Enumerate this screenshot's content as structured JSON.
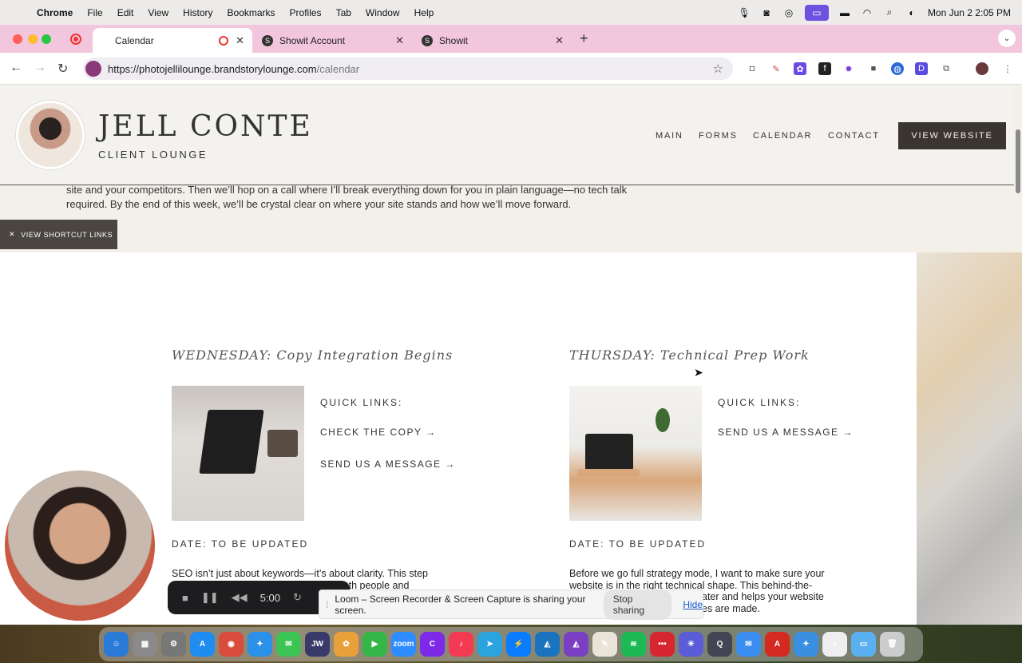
{
  "menubar": {
    "app_name": "Chrome",
    "items": [
      "File",
      "Edit",
      "View",
      "History",
      "Bookmarks",
      "Profiles",
      "Tab",
      "Window",
      "Help"
    ],
    "datetime": "Mon Jun 2  2:05 PM"
  },
  "tabs": [
    {
      "title": "Calendar",
      "active": true
    },
    {
      "title": "Showit Account",
      "active": false
    },
    {
      "title": "Showit",
      "active": false
    }
  ],
  "address_bar": {
    "url_host": "https://photojellilounge.brandstorylounge.com",
    "url_path": "/calendar"
  },
  "site": {
    "brand_name": "JELL CONTE",
    "brand_sub": "CLIENT LOUNGE",
    "nav": [
      "MAIN",
      "FORMS",
      "CALENDAR",
      "CONTACT"
    ],
    "cta": "VIEW WEBSITE",
    "intro_line1": "site and your competitors. Then we’ll hop on a call where I’ll break everything down for you in plain language—no tech talk",
    "intro_line2": "required. By the end of this week, we’ll be crystal clear on where your site stands and how we’ll move forward.",
    "shortcut_label": "VIEW SHORTCUT LINKS",
    "shortcut_icon": "close-icon"
  },
  "days": [
    {
      "title": "WEDNESDAY: Copy Integration Begins",
      "quick_links_title": "QUICK LINKS:",
      "links": [
        "CHECK THE COPY →",
        "SEND US A MESSAGE  →"
      ],
      "date": "DATE: TO BE UPDATED",
      "desc_line1": "SEO isn’t just about keywords—it’s about clarity. This step",
      "desc_line2": "y both people and"
    },
    {
      "title": "THURSDAY: Technical Prep Work",
      "quick_links_title": "QUICK LINKS:",
      "links": [
        "SEND US A MESSAGE  →"
      ],
      "date": "DATE: TO BE UPDATED",
      "desc_line1": "Before we go full strategy mode, I want to make sure your",
      "desc_line2": "website is in the right technical shape. This behind-the-",
      "desc_line3": "ater and helps your website",
      "desc_line4": "es are made."
    }
  ],
  "loom": {
    "timer": "5:00",
    "share_message": "Loom – Screen Recorder & Screen Capture is sharing your screen.",
    "stop_label": "Stop sharing",
    "hide_label": "Hide"
  },
  "dock": {
    "apps": [
      {
        "name": "finder",
        "color": "#2a7bd8",
        "glyph": "☺"
      },
      {
        "name": "launchpad",
        "color": "#8a8a8a",
        "glyph": "▦"
      },
      {
        "name": "system-settings",
        "color": "#777",
        "glyph": "⚙"
      },
      {
        "name": "app-store",
        "color": "#1e8cf0",
        "glyph": "A"
      },
      {
        "name": "chrome",
        "color": "#d94b3b",
        "glyph": "◉"
      },
      {
        "name": "safari",
        "color": "#2b90e8",
        "glyph": "✦"
      },
      {
        "name": "messages",
        "color": "#3bc454",
        "glyph": "✉"
      },
      {
        "name": "jw-library",
        "color": "#3a3a6a",
        "glyph": "JW"
      },
      {
        "name": "photos",
        "color": "#e8a13a",
        "glyph": "✿"
      },
      {
        "name": "facetime",
        "color": "#35b748",
        "glyph": "▶"
      },
      {
        "name": "zoom",
        "color": "#2d8cff",
        "glyph": "zoom"
      },
      {
        "name": "canva",
        "color": "#7d2ae8",
        "glyph": "C"
      },
      {
        "name": "music",
        "color": "#f23b52",
        "glyph": "♪"
      },
      {
        "name": "telegram",
        "color": "#2aa3df",
        "glyph": "➤"
      },
      {
        "name": "messenger",
        "color": "#0a7cff",
        "glyph": "⚡"
      },
      {
        "name": "affinity-designer",
        "color": "#1b72be",
        "glyph": "◭"
      },
      {
        "name": "affinity-photo",
        "color": "#7b3fc4",
        "glyph": "◭"
      },
      {
        "name": "freeform",
        "color": "#e9e4d8",
        "glyph": "✎"
      },
      {
        "name": "spotify",
        "color": "#1db954",
        "glyph": "≋"
      },
      {
        "name": "scrobbles",
        "color": "#d6262f",
        "glyph": "•••"
      },
      {
        "name": "perplexity",
        "color": "#5a5cd8",
        "glyph": "✳"
      },
      {
        "name": "quicktime",
        "color": "#445",
        "glyph": "Q"
      },
      {
        "name": "mail",
        "color": "#3b8ef0",
        "glyph": "✉"
      },
      {
        "name": "acrobat",
        "color": "#d42a20",
        "glyph": "A"
      },
      {
        "name": "safari-beta",
        "color": "#3a8fe0",
        "glyph": "✦"
      },
      {
        "name": "document-preview",
        "color": "#eee",
        "glyph": "≡"
      },
      {
        "name": "downloads-folder",
        "color": "#5ab0f0",
        "glyph": "▭"
      },
      {
        "name": "trash",
        "color": "#ccc",
        "glyph": "🗑"
      }
    ]
  }
}
